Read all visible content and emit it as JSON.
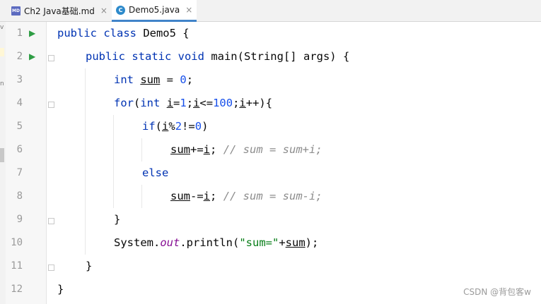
{
  "tabs": [
    {
      "label": "Ch2 Java基础.md",
      "icon": "markdown-file-icon",
      "icon_text": "MD",
      "active": false
    },
    {
      "label": "Demo5.java",
      "icon": "java-class-icon",
      "icon_text": "C",
      "active": true
    }
  ],
  "close_glyph": "×",
  "run_glyph": "▶",
  "line_numbers": [
    "1",
    "2",
    "3",
    "4",
    "5",
    "6",
    "7",
    "8",
    "9",
    "10",
    "11",
    "12"
  ],
  "strip_text": {
    "a": "v",
    "b": "n"
  },
  "code": {
    "l1": {
      "a": "public class",
      "b": " Demo5 {"
    },
    "l2": {
      "a": "public static void",
      "b": " main(String[] args) {"
    },
    "l3": {
      "a": "int",
      "b": " ",
      "c": "sum",
      "d": " = ",
      "e": "0",
      "f": ";"
    },
    "l4": {
      "a": "for",
      "b": "(",
      "c": "int",
      "d": " ",
      "e": "i",
      "f": "=",
      "g": "1",
      "h": ";",
      "i": "i",
      "j": "<=",
      "k": "100",
      "l": ";",
      "m": "i",
      "n": "++){"
    },
    "l5": {
      "a": "if",
      "b": "(",
      "c": "i",
      "d": "%",
      "e": "2",
      "f": "!=",
      "g": "0",
      "h": ")"
    },
    "l6": {
      "a": "sum",
      "b": "+=",
      "c": "i",
      "d": "; ",
      "e": "// sum = sum+i;"
    },
    "l7": {
      "a": "else"
    },
    "l8": {
      "a": "sum",
      "b": "-=",
      "c": "i",
      "d": "; ",
      "e": "// sum = sum-i;"
    },
    "l9": {
      "a": "}"
    },
    "l10": {
      "a": "System.",
      "b": "out",
      "c": ".println(",
      "d": "\"sum=\"",
      "e": "+",
      "f": "sum",
      "g": ");"
    },
    "l11": {
      "a": "}"
    },
    "l12": {
      "a": "}"
    }
  },
  "watermark": "CSDN @背包客w",
  "colors": {
    "keyword": "#0033b3",
    "number": "#1750eb",
    "string": "#067d17",
    "comment": "#8c8c8c",
    "field": "#871094",
    "run": "#2e9d44"
  }
}
